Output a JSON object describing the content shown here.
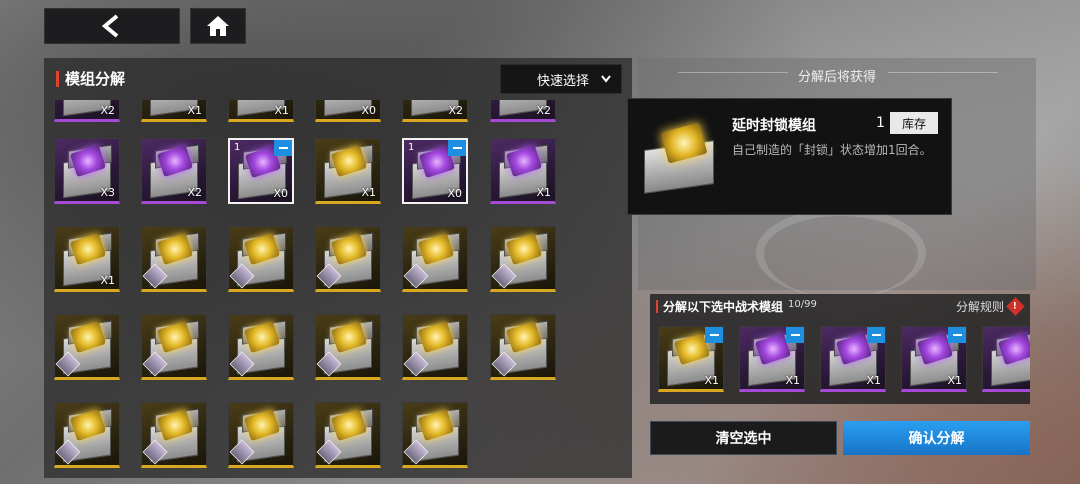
{
  "left_panel": {
    "title": "模组分解",
    "quick_select_label": "快速选择"
  },
  "grid": {
    "row0": [
      {
        "rarity": "purple",
        "count": "X2"
      },
      {
        "rarity": "gold",
        "count": "X1"
      },
      {
        "rarity": "gold",
        "count": "X1"
      },
      {
        "rarity": "gold",
        "count": "X0"
      },
      {
        "rarity": "gold",
        "count": "X2"
      },
      {
        "rarity": "purple",
        "count": "X2"
      }
    ],
    "row1": [
      {
        "rarity": "purple",
        "count": "X3",
        "selected": false
      },
      {
        "rarity": "purple",
        "count": "X2",
        "selected": false
      },
      {
        "rarity": "purple",
        "count": "X0",
        "selected": true,
        "selected_count": "1"
      },
      {
        "rarity": "gold",
        "count": "X1",
        "selected": false
      },
      {
        "rarity": "purple",
        "count": "X0",
        "selected": true,
        "selected_count": "1"
      },
      {
        "rarity": "purple",
        "count": "X1",
        "selected": false
      }
    ],
    "row2": [
      {
        "rarity": "gold",
        "count": "X1"
      },
      {
        "rarity": "gold",
        "count": ""
      },
      {
        "rarity": "gold",
        "count": ""
      },
      {
        "rarity": "gold",
        "count": ""
      },
      {
        "rarity": "gold",
        "count": ""
      },
      {
        "rarity": "gold",
        "count": ""
      }
    ],
    "row3": [
      {
        "rarity": "gold",
        "count": ""
      },
      {
        "rarity": "gold",
        "count": ""
      },
      {
        "rarity": "gold",
        "count": ""
      },
      {
        "rarity": "gold",
        "count": ""
      },
      {
        "rarity": "gold",
        "count": ""
      },
      {
        "rarity": "gold",
        "count": ""
      }
    ],
    "row4": [
      {
        "rarity": "gold",
        "count": ""
      },
      {
        "rarity": "gold",
        "count": ""
      },
      {
        "rarity": "gold",
        "count": ""
      },
      {
        "rarity": "gold",
        "count": ""
      },
      {
        "rarity": "gold",
        "count": ""
      }
    ]
  },
  "result_panel": {
    "title": "分解后将获得"
  },
  "tooltip": {
    "name": "延时封锁模组",
    "count": "1",
    "stock_label": "库存",
    "description": "自己制造的「封锁」状态增加1回合。"
  },
  "selection": {
    "title": "分解以下选中战术模组",
    "count": "10/99",
    "rules_label": "分解规则",
    "warn_icon": "!",
    "items": [
      {
        "rarity": "gold",
        "count": "X1"
      },
      {
        "rarity": "purple",
        "count": "X1"
      },
      {
        "rarity": "purple",
        "count": "X1"
      },
      {
        "rarity": "purple",
        "count": "X1"
      },
      {
        "rarity": "purple",
        "count": ""
      }
    ]
  },
  "buttons": {
    "clear": "清空选中",
    "confirm": "确认分解"
  },
  "icons": {
    "back": "back-arrow-icon",
    "home": "home-icon",
    "dropdown": "chevron-down-icon"
  },
  "colors": {
    "purple": "#a54ad4",
    "gold": "#d8a821",
    "accent_blue": "#1e8ee0",
    "title_bar": "#e0442a"
  }
}
